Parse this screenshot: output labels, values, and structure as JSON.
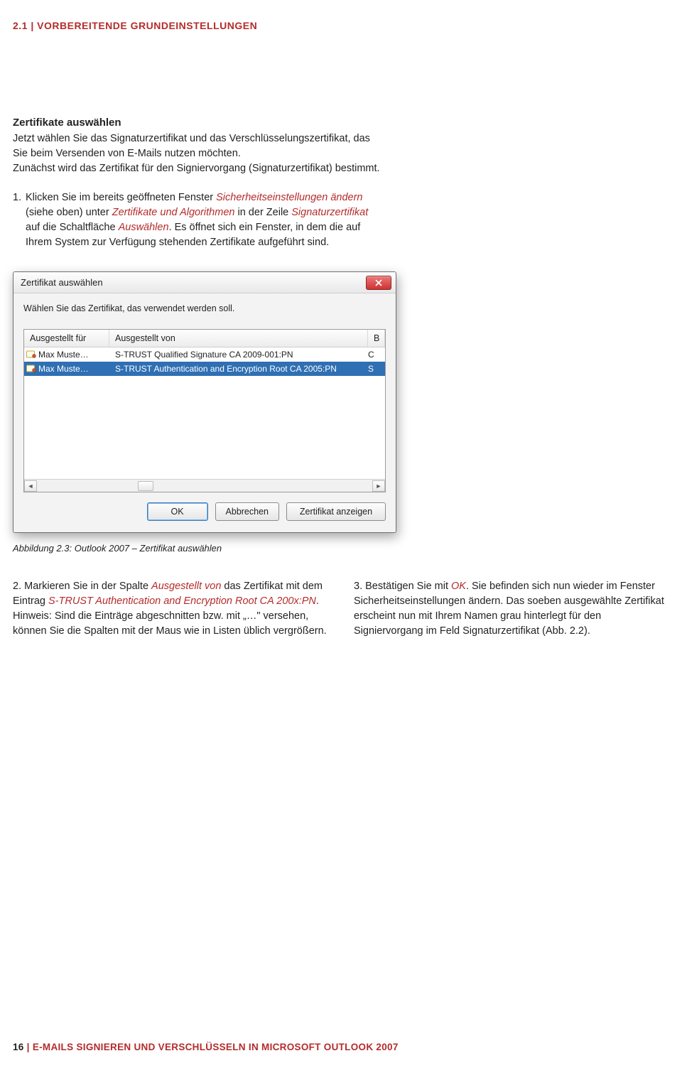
{
  "header": {
    "breadcrumb": "2.1  |  VORBEREITENDE GRUNDEINSTELLUNGEN"
  },
  "section": {
    "title": "Zertifikate auswählen",
    "intro": "Jetzt wählen Sie das Signaturzertifikat und das Verschlüsselungszertifikat, das Sie beim Versenden von E-Mails nutzen möchten.\nZunächst wird das Zertifikat für den Signiervorgang (Signaturzertifikat) bestimmt."
  },
  "step1": {
    "num": "1.",
    "t1": "Klicken Sie im bereits geöffneten Fenster ",
    "r1": "Sicherheitseinstellungen ändern",
    "t2": " (siehe oben) unter ",
    "r2": "Zertifikate und Algorithmen",
    "t3": " in der Zeile ",
    "r3": "Signaturzertifikat",
    "t4": " auf die Schaltfläche ",
    "r4": "Auswählen",
    "t5": ". Es öffnet sich ein Fenster, in dem die auf Ihrem System zur Verfügung stehenden Zertifikate aufgeführt sind."
  },
  "dialog": {
    "title": "Zertifikat auswählen",
    "prompt": "Wählen Sie das Zertifikat, das verwendet werden soll.",
    "columns": {
      "a": "Ausgestellt für",
      "b": "Ausgestellt von",
      "c": "B"
    },
    "rows": [
      {
        "a": "Max Muste…",
        "b": "S-TRUST Qualified Signature CA 2009-001:PN",
        "c": "C",
        "selected": false
      },
      {
        "a": "Max Muste…",
        "b": "S-TRUST Authentication and Encryption Root CA 2005:PN",
        "c": "S",
        "selected": true
      }
    ],
    "buttons": {
      "ok": "OK",
      "cancel": "Abbrechen",
      "view": "Zertifikat anzeigen"
    }
  },
  "caption": "Abbildung 2.3: Outlook 2007 – Zertifikat auswählen",
  "step2": {
    "num": "2.",
    "t1": " Markieren Sie in der Spalte ",
    "r1": "Ausgestellt von",
    "t2": " das Zertifikat mit dem Eintrag ",
    "r2": "S-TRUST Authentication and Encryption Root CA 200x:PN",
    "t3": ". Hinweis: Sind die Einträge abgeschnitten bzw. mit „…\" versehen, können Sie die Spalten mit der Maus wie in Listen üblich vergrößern."
  },
  "step3": {
    "num": "3.",
    "t1": " Bestätigen Sie mit ",
    "r1": "OK",
    "t2": ". Sie befinden sich nun wieder im Fenster Sicherheitseinstellungen ändern. Das soeben ausgewählte Zertifikat erscheint nun mit Ihrem Namen grau hinterlegt für den Signiervorgang im Feld Signaturzertifikat (Abb. 2.2)."
  },
  "footer": {
    "page": "16",
    "sep": "  |  ",
    "title": "E-MAILS SIGNIEREN UND VERSCHLÜSSELN IN MICROSOFT OUTLOOK 2007"
  }
}
